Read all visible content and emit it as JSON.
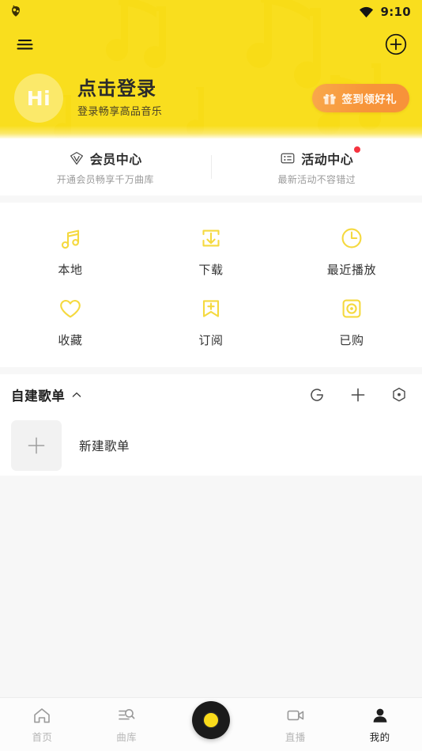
{
  "statusbar": {
    "app_icon": "app-badge-icon",
    "wifi_icon": "wifi-icon",
    "time": "9:10"
  },
  "header": {
    "menu_icon": "hamburger-menu-icon",
    "add_icon": "plus-circle-icon",
    "avatar_text": "Hi",
    "login_title": "点击登录",
    "login_subtitle": "登录畅享高品音乐",
    "signin_label": "签到领好礼",
    "signin_icon": "gift-icon",
    "bg_color": "#f9de1e",
    "signin_color": "#f7953a"
  },
  "vip_row": {
    "items": [
      {
        "icon": "vip-shield-icon",
        "title": "会员中心",
        "subtitle": "开通会员畅享千万曲库",
        "badge": false
      },
      {
        "icon": "activity-list-icon",
        "title": "活动中心",
        "subtitle": "最新活动不容错过",
        "badge": true
      }
    ],
    "badge_color": "#f5333f"
  },
  "grid": {
    "icon_color": "#f5d93f",
    "rows": [
      [
        {
          "icon": "music-note-icon",
          "label": "本地"
        },
        {
          "icon": "download-icon",
          "label": "下载"
        },
        {
          "icon": "clock-icon",
          "label": "最近播放"
        }
      ],
      [
        {
          "icon": "heart-icon",
          "label": "收藏"
        },
        {
          "icon": "bookmark-plus-icon",
          "label": "订阅"
        },
        {
          "icon": "purchased-disc-icon",
          "label": "已购"
        }
      ]
    ]
  },
  "playlist": {
    "title": "自建歌单",
    "collapse_icon": "chevron-up-icon",
    "actions": [
      {
        "icon": "sync-icon"
      },
      {
        "icon": "plus-icon"
      },
      {
        "icon": "hexagon-dot-icon"
      }
    ],
    "items": [
      {
        "icon": "plus-icon",
        "name": "新建歌单"
      }
    ]
  },
  "bottomnav": {
    "items": [
      {
        "icon": "home-icon",
        "label": "首页",
        "active": false
      },
      {
        "icon": "library-search-icon",
        "label": "曲库",
        "active": false
      },
      {
        "icon": "vinyl-disc-icon",
        "label": "",
        "active": false
      },
      {
        "icon": "live-video-icon",
        "label": "直播",
        "active": false
      },
      {
        "icon": "person-icon",
        "label": "我的",
        "active": true
      }
    ],
    "active_color": "#1f1f1f",
    "inactive_color": "#b6b6b6",
    "disc_center_color": "#fadb1b"
  }
}
